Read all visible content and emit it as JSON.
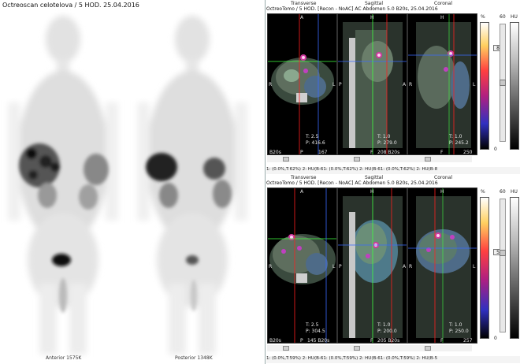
{
  "whole_body": {
    "title": "Octreoscan celotelova / 5 HOD. 25.04.2016",
    "anterior_label": "Anterior 1575K",
    "posterior_label": "Posterior 1348K"
  },
  "colors": {
    "background": "#ffffff",
    "ct_tile": "#000000",
    "crosshair_red": "#ff2020",
    "crosshair_green": "#40ff40",
    "crosshair_blue": "#3a6bff"
  },
  "upper": {
    "header_titles": [
      "Transverse",
      "Sagittal",
      "Coronal"
    ],
    "header_line": "OctreoTomo / 5 HOD. [Recon - NoAC]     AC Abdomen 5.0 B20s, 25.04.2016",
    "tiles": {
      "transverse": {
        "top": "A",
        "left": "R",
        "right": "L",
        "bottom": "P",
        "readout1": "T: 2.5",
        "readout2": "P: 416.6",
        "bl": "B20s",
        "br": "167"
      },
      "sagittal": {
        "top": "H",
        "left": "P",
        "right": "A",
        "bottom": "F",
        "readout1": "T: 1.0",
        "readout2": "P: 279.0",
        "bl": "",
        "br": "208 B20s"
      },
      "coronal": {
        "top": "H",
        "left": "R",
        "right": "L",
        "bottom": "F",
        "readout1": "T: 1.0",
        "readout2": "P: 245.2",
        "bl": "",
        "br": "250"
      }
    },
    "colorbar": {
      "top_label": "%",
      "top_value": "82",
      "bottom_value": "0",
      "unit": "HU",
      "max": "60"
    },
    "status": "1: (0.0%,T:62%) 2: HU(B-61: (0.0%,T:62%) 2: HU(B-61: (0.0%,T:62%) 2: HU(B-8"
  },
  "lower": {
    "header_titles": [
      "Transverse",
      "Sagittal",
      "Coronal"
    ],
    "header_line": "OctreoTomo / 5 HOD. [Recon - NoAC]     AC Abdomen 5.0 B20s, 25.04.2016",
    "tiles": {
      "transverse": {
        "top": "A",
        "left": "R",
        "right": "L",
        "bottom": "P",
        "readout1": "T: 2.5",
        "readout2": "P: 304.5",
        "bl": "B20s",
        "br": "145 B20s"
      },
      "sagittal": {
        "top": "H",
        "left": "P",
        "right": "A",
        "bottom": "F",
        "readout1": "T: 1.0",
        "readout2": "P: 200.0",
        "bl": "",
        "br": "205 B20s"
      },
      "coronal": {
        "top": "H",
        "left": "R",
        "right": "L",
        "bottom": "F",
        "readout1": "T: 1.0",
        "readout2": "P: 250.0",
        "bl": "",
        "br": "257"
      }
    },
    "colorbar": {
      "top_label": "%",
      "top_value": "59",
      "bottom_value": "0",
      "unit": "HU",
      "max": "60"
    },
    "status": "1: (0.0%,T:59%) 2: HU(B-61: (0.0%,T:59%) 2: HU(B-61: (0.0%,T:59%) 2: HU(B-5"
  }
}
